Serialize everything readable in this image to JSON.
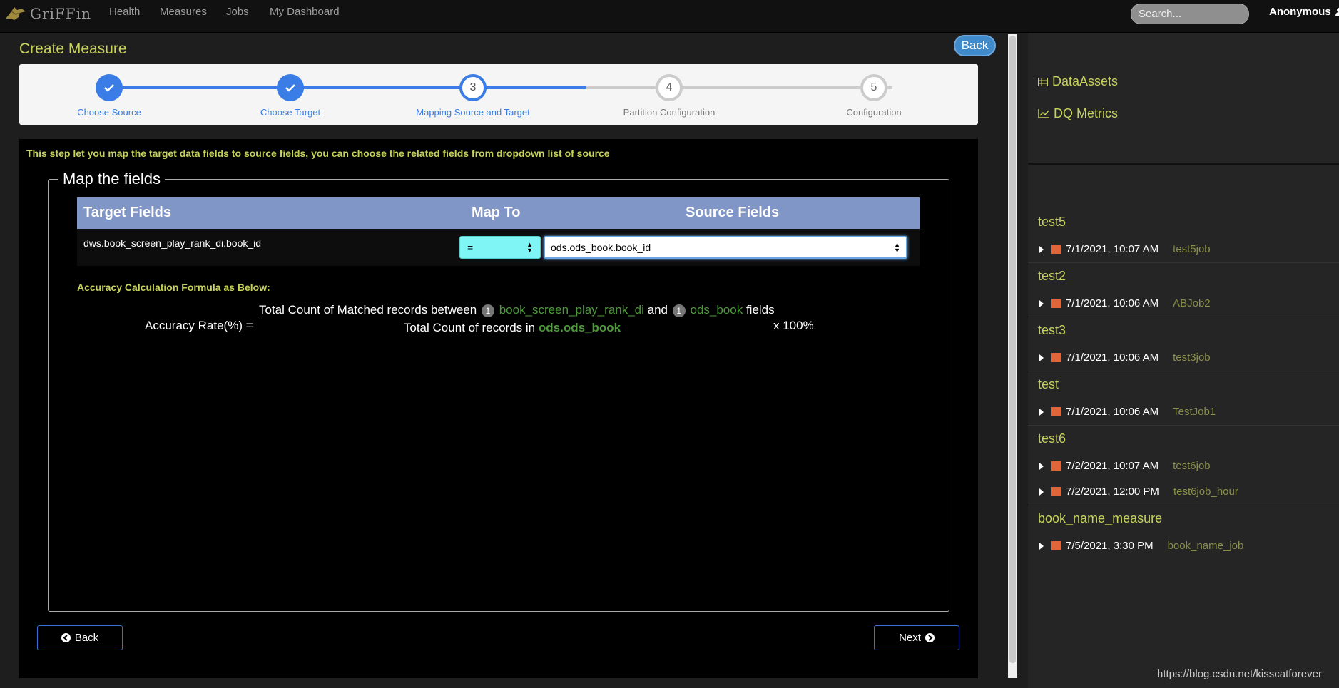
{
  "nav": {
    "brand": "GriFFin",
    "links": [
      "Health",
      "Measures",
      "Jobs",
      "My Dashboard"
    ],
    "search_placeholder": "Search...",
    "user": "Anonymous"
  },
  "page": {
    "title": "Create Measure",
    "back_label": "Back"
  },
  "wizard": {
    "steps": [
      {
        "label": "Choose Source",
        "state": "done"
      },
      {
        "label": "Choose Target",
        "state": "done"
      },
      {
        "label": "Mapping Source and Target",
        "number": "3",
        "state": "current"
      },
      {
        "label": "Partition Configuration",
        "number": "4",
        "state": "todo"
      },
      {
        "label": "Configuration",
        "number": "5",
        "state": "todo"
      }
    ]
  },
  "mapping": {
    "hint": "This step let you map the target data fields to source fields, you can choose the related fields from dropdown list of source",
    "legend": "Map the fields",
    "headers": {
      "target": "Target Fields",
      "map_to": "Map To",
      "source": "Source Fields"
    },
    "row": {
      "target": "dws.book_screen_play_rank_di.book_id",
      "map_to": "=",
      "source": "ods.ods_book.book_id"
    }
  },
  "formula": {
    "title": "Accuracy Calculation Formula as Below:",
    "left": "Accuracy Rate(%) =",
    "num_prefix": "Total Count of Matched records between",
    "badge1": "1",
    "table1": "book_screen_play_rank_di",
    "and": "and",
    "badge2": "1",
    "table2": "ods_book",
    "suffix": "fields",
    "den_prefix": "Total Count of records in",
    "den_table": "ods.ods_book",
    "right": "x 100%"
  },
  "buttons": {
    "back": "Back",
    "next": "Next"
  },
  "sidebar": {
    "links": [
      "DataAssets",
      "DQ Metrics"
    ],
    "measures": [
      {
        "name": "test5",
        "jobs": [
          {
            "time": "7/1/2021, 10:07 AM",
            "job": "test5job"
          }
        ]
      },
      {
        "name": "test2",
        "jobs": [
          {
            "time": "7/1/2021, 10:06 AM",
            "job": "ABJob2"
          }
        ]
      },
      {
        "name": "test3",
        "jobs": [
          {
            "time": "7/1/2021, 10:06 AM",
            "job": "test3job"
          }
        ]
      },
      {
        "name": "test",
        "jobs": [
          {
            "time": "7/1/2021, 10:06 AM",
            "job": "TestJob1"
          }
        ]
      },
      {
        "name": "test6",
        "jobs": [
          {
            "time": "7/2/2021, 10:07 AM",
            "job": "test6job"
          },
          {
            "time": "7/2/2021, 12:00 PM",
            "job": "test6job_hour"
          }
        ]
      },
      {
        "name": "book_name_measure",
        "jobs": [
          {
            "time": "7/5/2021, 3:30 PM",
            "job": "book_name_job"
          }
        ]
      }
    ]
  },
  "watermark": "https://blog.csdn.net/kisscatforever",
  "colors": {
    "accent": "#c6d25a",
    "primary": "#3b7de6",
    "header": "#8096c7",
    "select_cyan": "#7ff5f5",
    "link_green": "#4e9a3a"
  }
}
